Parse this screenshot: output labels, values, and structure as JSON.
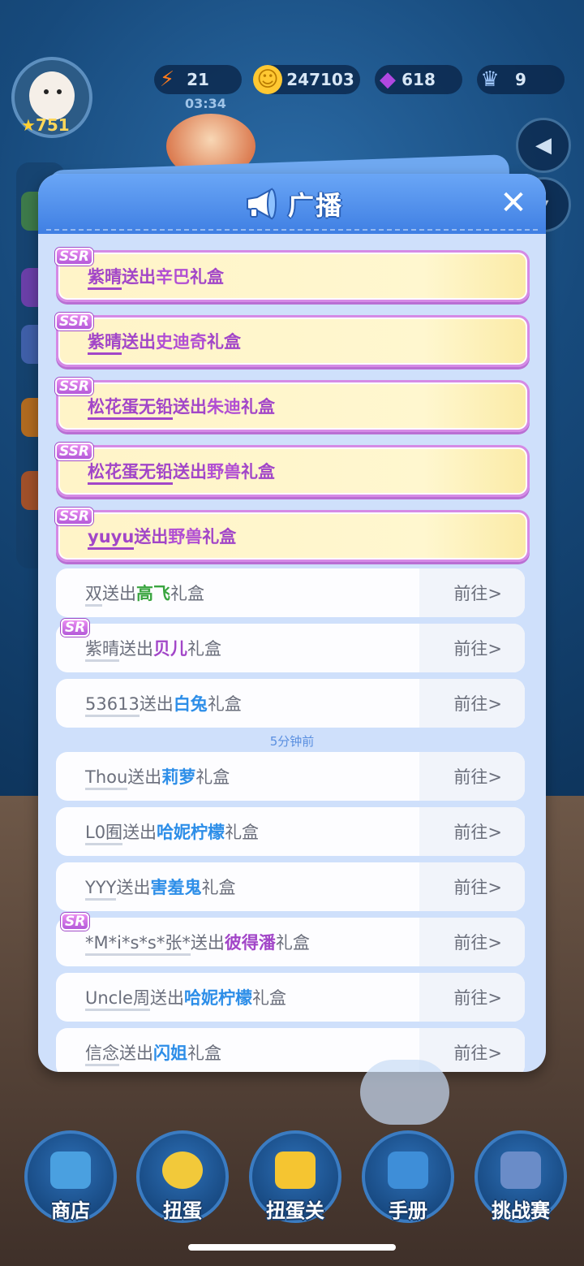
{
  "hud": {
    "level": "751",
    "energy": "21",
    "coins": "247103",
    "gems": "618",
    "crowns": "9",
    "timer": "03:34"
  },
  "modal": {
    "title": "广播",
    "close_icon": "close-icon"
  },
  "broadcasts_ssr": [
    {
      "badge": "SSR",
      "user": "紫晴",
      "verb": "送出",
      "gift": "辛巴",
      "suffix": "礼盒"
    },
    {
      "badge": "SSR",
      "user": "紫晴",
      "verb": "送出",
      "gift": "史迪奇",
      "suffix": "礼盒"
    },
    {
      "badge": "SSR",
      "user": "松花蛋无铅",
      "verb": "送出",
      "gift": "朱迪",
      "suffix": "礼盒"
    },
    {
      "badge": "SSR",
      "user": "松花蛋无铅",
      "verb": "送出",
      "gift": "野兽",
      "suffix": "礼盒"
    },
    {
      "badge": "SSR",
      "user": "yuyu",
      "verb": "送出",
      "gift": "野兽",
      "suffix": "礼盒"
    }
  ],
  "broadcasts_recent": [
    {
      "user": "双",
      "verb": "送出",
      "gift": "高飞",
      "suffix": "礼盒",
      "go": "前往>"
    },
    {
      "badge": "SR",
      "user": "紫晴",
      "verb": "送出",
      "gift": "贝儿",
      "suffix": "礼盒",
      "go": "前往>"
    },
    {
      "user": "53613",
      "verb": "送出",
      "gift": "白兔",
      "suffix": "礼盒",
      "go": "前往>"
    }
  ],
  "time_separator": "5分钟前",
  "broadcasts_older": [
    {
      "user": "Thou",
      "verb": "送出",
      "gift": "莉萝",
      "suffix": "礼盒",
      "go": "前往>"
    },
    {
      "user": "L0囿",
      "verb": "送出",
      "gift": "哈妮柠檬",
      "suffix": "礼盒",
      "go": "前往>"
    },
    {
      "user": "YYY",
      "verb": "送出",
      "gift": "害羞鬼",
      "suffix": "礼盒",
      "go": "前往>"
    },
    {
      "badge": "SR",
      "user": "*M*i*s*s*张*",
      "verb": "送出",
      "gift": "彼得潘",
      "suffix": "礼盒",
      "go": "前往>"
    },
    {
      "user": "Uncle周",
      "verb": "送出",
      "gift": "哈妮柠檬",
      "suffix": "礼盒",
      "go": "前往>"
    },
    {
      "user": "信念",
      "verb": "送出",
      "gift": "闪姐",
      "suffix": "礼盒",
      "go": "前往>"
    }
  ],
  "nav": [
    "商店",
    "扭蛋",
    "扭蛋关",
    "手册",
    "挑战赛"
  ],
  "colors": {
    "header_blue": "#3f7fe3",
    "ssr_purple": "#a246c8",
    "gift_blue": "#2d8ee8",
    "gift_green": "#3aa540"
  }
}
